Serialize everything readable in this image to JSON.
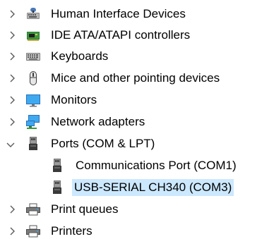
{
  "tree": {
    "items": [
      {
        "label": "Human Interface Devices",
        "icon": "hid-icon",
        "expander": "collapsed"
      },
      {
        "label": "IDE ATA/ATAPI controllers",
        "icon": "ide-controller-icon",
        "expander": "collapsed"
      },
      {
        "label": "Keyboards",
        "icon": "keyboard-icon",
        "expander": "collapsed"
      },
      {
        "label": "Mice and other pointing devices",
        "icon": "mouse-icon",
        "expander": "collapsed"
      },
      {
        "label": "Monitors",
        "icon": "monitor-icon",
        "expander": "collapsed"
      },
      {
        "label": "Network adapters",
        "icon": "network-adapter-icon",
        "expander": "collapsed"
      },
      {
        "label": "Ports (COM & LPT)",
        "icon": "port-icon",
        "expander": "expanded",
        "children": [
          {
            "label": "Communications Port (COM1)",
            "icon": "port-icon"
          },
          {
            "label": "USB-SERIAL CH340 (COM3)",
            "icon": "port-icon",
            "selected": true
          }
        ]
      },
      {
        "label": "Print queues",
        "icon": "printer-icon",
        "expander": "collapsed"
      },
      {
        "label": "Printers",
        "icon": "printer-icon",
        "expander": "collapsed"
      }
    ]
  },
  "colors": {
    "selection": "#cce8ff",
    "expander": "#5a5a5a"
  }
}
